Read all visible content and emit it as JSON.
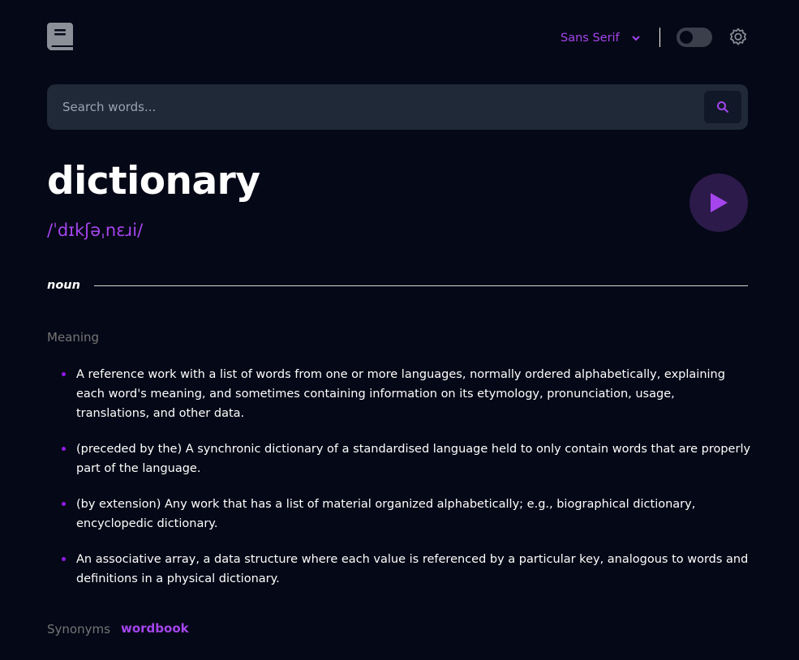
{
  "header": {
    "logo_icon": "book-icon",
    "font_select": {
      "selected": "Sans Serif"
    },
    "theme_toggle": {
      "state": "off"
    },
    "settings_icon": "gear-icon"
  },
  "search": {
    "placeholder": "Search words...",
    "value": ""
  },
  "entry": {
    "word": "dictionary",
    "phonetic": "/ˈdɪkʃəˌnɛɹi/",
    "play_icon": "play-icon",
    "part_of_speech": "noun",
    "meaning_label": "Meaning",
    "definitions": [
      "A reference work with a list of words from one or more languages, normally ordered alphabetically, explaining each word's meaning, and sometimes containing information on its etymology, pronunciation, usage, translations, and other data.",
      "(preceded by the) A synchronic dictionary of a standardised language held to only contain words that are properly part of the language.",
      "(by extension) Any work that has a list of material organized alphabetically; e.g., biographical dictionary, encyclopedic dictionary.",
      "An associative array, a data structure where each value is referenced by a particular key, analogous to words and definitions in a physical dictionary."
    ],
    "synonyms_label": "Synonyms",
    "synonyms": [
      "wordbook"
    ]
  },
  "colors": {
    "background": "#050816",
    "accent": "#a445ed",
    "muted": "#757575",
    "search_bg": "#1f2937"
  }
}
